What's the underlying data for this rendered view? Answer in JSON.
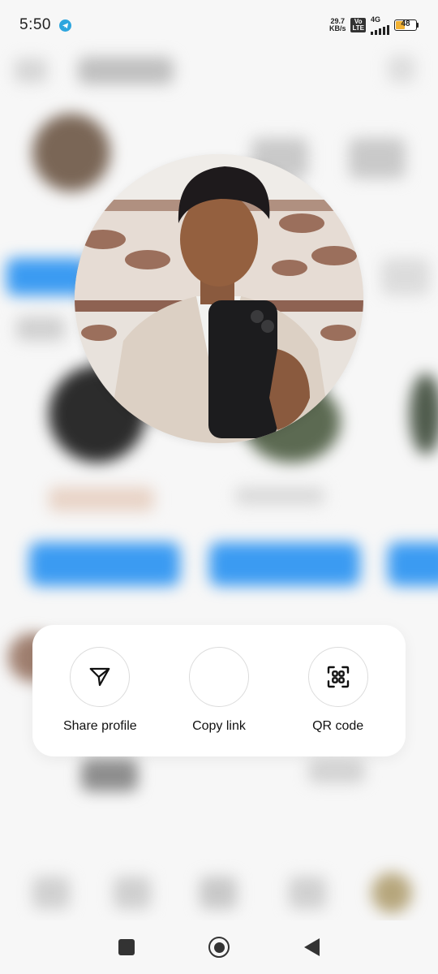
{
  "status_bar": {
    "time": "5:50",
    "net_speed_value": "29.7",
    "net_speed_unit": "KB/s",
    "volte_top": "Vo",
    "volte_bottom": "LTE",
    "network": "4G",
    "battery": "48",
    "battery_fraction": 0.48,
    "notification_icon": "telegram-icon"
  },
  "share_sheet": {
    "actions": [
      {
        "label": "Share profile",
        "icon": "send-icon"
      },
      {
        "label": "Copy link",
        "icon": ""
      },
      {
        "label": "QR code",
        "icon": "qr-code-icon"
      }
    ]
  },
  "nav_bar": {
    "icons": [
      "recents-square-icon",
      "home-circle-icon",
      "back-triangle-icon"
    ]
  },
  "colors": {
    "accent_blue": "#3b9bf2",
    "battery_yellow": "#f2b233",
    "card_bg": "#ffffff"
  }
}
